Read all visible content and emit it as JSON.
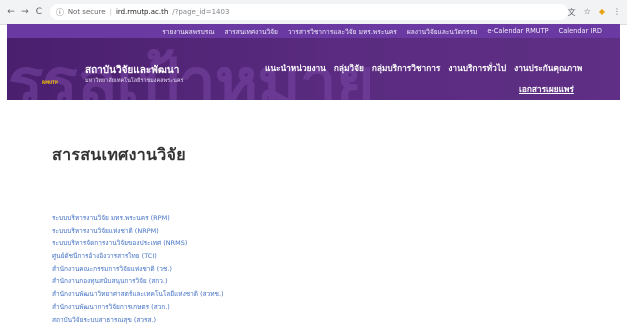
{
  "browser": {
    "back_glyph": "←",
    "forward_glyph": "→",
    "reload_glyph": "C",
    "info_glyph": "ⓘ",
    "security_label": "Not secure",
    "separator": "|",
    "url_host": "ird.rmutp.ac.th",
    "url_path": "/?page_id=1403",
    "translate_glyph": "文",
    "star_glyph": "☆",
    "extension_glyph": "◆",
    "menu_glyph": "⋮"
  },
  "header": {
    "top_links": [
      "รายงานผลพรบรณ",
      "สารสนเทศงานวิจัย",
      "วารสารวิชาการและวิจัย มทร.พระนคร",
      "ผลงานวิจัยและนวัตกรรม",
      "e-Calendar RMUTP",
      "Calendar IRD"
    ],
    "watermark": "บรรลุเป้าหมาย",
    "logo_badge": "RMUTP",
    "logo_title": "สถาบันวิจัยและพัฒนา",
    "logo_subtitle": "มหาวิทยาลัยเทคโนโลยีราชมงคลพระนคร",
    "main_nav": [
      "แนะนำหน่วยงาน",
      "กลุ่มวิจัย",
      "กลุ่มบริการวิชาการ",
      "งานบริการทั่วไป",
      "งานประกันคุณภาพ"
    ],
    "main_nav_extra": "เอกสารเผยแพร่"
  },
  "content": {
    "title": "สารสนเทศงานวิจัย",
    "links": [
      "ระบบบริหารงานวิจัย มทร.พระนคร (RPM)",
      "ระบบบริหารงานวิจัยแห่งชาติ (NRPM)",
      "ระบบบริหารจัดการงานวิจัยของประเทศ (NRMS)",
      "ศูนย์ดัชนีการอ้างอิงวารสารไทย (TCI)",
      "สำนักงานคณะกรรมการวิจัยแห่งชาติ (วช.)",
      "สำนักงานกองทุนสนับสนุนการวิจัย (สกว.)",
      "สำนักงานพัฒนาวิทยาศาสตร์และเทคโนโลยีแห่งชาติ (สวทช.)",
      "สำนักงานพัฒนาการวิจัยการเกษตร (สวก.)",
      "สถาบันวิจัยระบบสาธารณสุข (สวรส.)"
    ]
  },
  "colors": {
    "header_purple": "#5b2a86",
    "top_bar_purple": "#6a3aa2",
    "link_blue": "#4472c4",
    "title_text": "#333333"
  }
}
